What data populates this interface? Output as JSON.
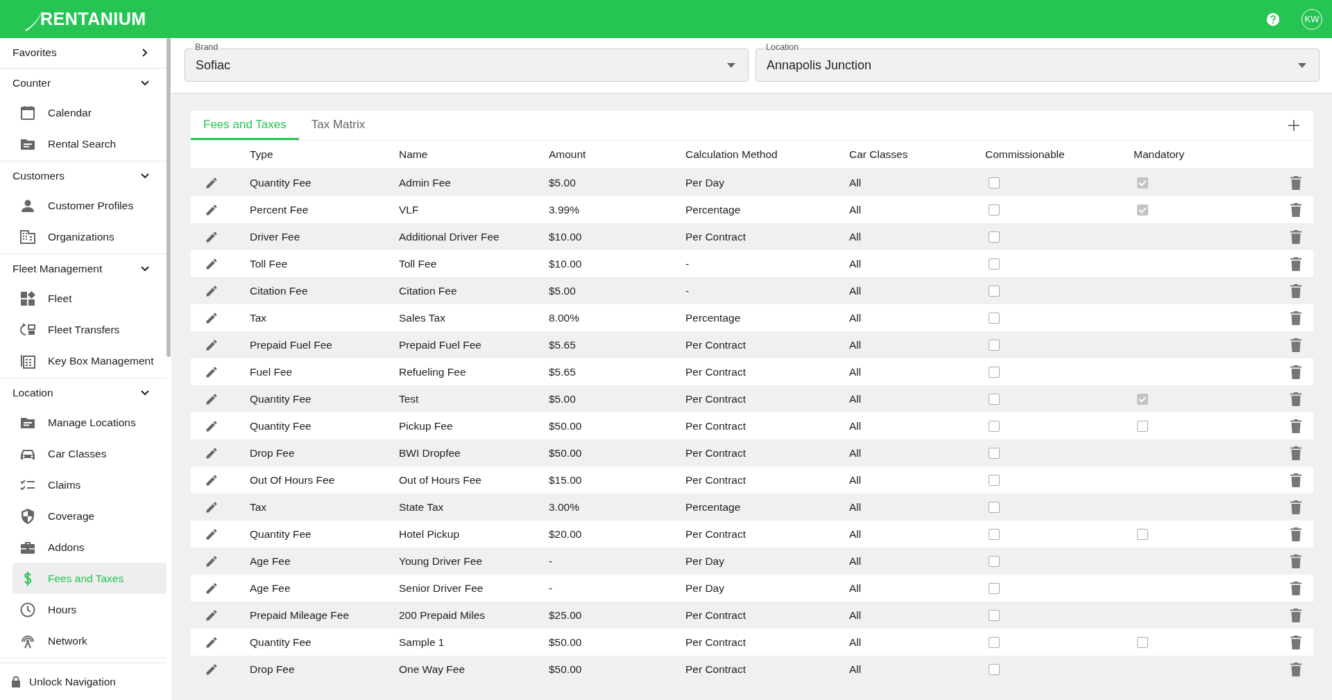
{
  "app": {
    "logo": "RENTANIUM",
    "avatar": "KW"
  },
  "sidebar": {
    "sections": [
      {
        "title": "Favorites",
        "expanded": false
      },
      {
        "title": "Counter",
        "expanded": true,
        "items": [
          {
            "label": "Calendar",
            "selected": false
          },
          {
            "label": "Rental Search",
            "selected": false
          }
        ]
      },
      {
        "title": "Customers",
        "expanded": true,
        "items": [
          {
            "label": "Customer Profiles",
            "selected": false
          },
          {
            "label": "Organizations",
            "selected": false
          }
        ]
      },
      {
        "title": "Fleet Management",
        "expanded": true,
        "items": [
          {
            "label": "Fleet",
            "selected": false
          },
          {
            "label": "Fleet Transfers",
            "selected": false
          },
          {
            "label": "Key Box Management",
            "selected": false
          }
        ]
      },
      {
        "title": "Location",
        "expanded": true,
        "items": [
          {
            "label": "Manage Locations",
            "selected": false
          },
          {
            "label": "Car Classes",
            "selected": false
          },
          {
            "label": "Claims",
            "selected": false
          },
          {
            "label": "Coverage",
            "selected": false
          },
          {
            "label": "Addons",
            "selected": false
          },
          {
            "label": "Fees and Taxes",
            "selected": true
          },
          {
            "label": "Hours",
            "selected": false
          },
          {
            "label": "Network",
            "selected": false
          }
        ]
      }
    ],
    "footer": "Unlock Navigation"
  },
  "filters": [
    {
      "label": "Brand",
      "value": "Sofiac"
    },
    {
      "label": "Location",
      "value": "Annapolis Junction"
    }
  ],
  "tabs": [
    {
      "label": "Fees and Taxes",
      "selected": true
    },
    {
      "label": "Tax Matrix",
      "selected": false
    }
  ],
  "table": {
    "columns": [
      "Type",
      "Name",
      "Amount",
      "Calculation Method",
      "Car Classes",
      "Commissionable",
      "Mandatory"
    ],
    "rows": [
      {
        "type": "Quantity Fee",
        "name": "Admin Fee",
        "amount": "$5.00",
        "method": "Per Day",
        "car_classes": "All",
        "commissionable": false,
        "mandatory": true
      },
      {
        "type": "Percent Fee",
        "name": "VLF",
        "amount": "3.99%",
        "method": "Percentage",
        "car_classes": "All",
        "commissionable": false,
        "mandatory": true
      },
      {
        "type": "Driver Fee",
        "name": "Additional Driver Fee",
        "amount": "$10.00",
        "method": "Per Contract",
        "car_classes": "All",
        "commissionable": false
      },
      {
        "type": "Toll Fee",
        "name": "Toll Fee",
        "amount": "$10.00",
        "method": "-",
        "car_classes": "All",
        "commissionable": false
      },
      {
        "type": "Citation Fee",
        "name": "Citation Fee",
        "amount": "$5.00",
        "method": "-",
        "car_classes": "All",
        "commissionable": false
      },
      {
        "type": "Tax",
        "name": "Sales Tax",
        "amount": "8.00%",
        "method": "Percentage",
        "car_classes": "All",
        "commissionable": false
      },
      {
        "type": "Prepaid Fuel Fee",
        "name": "Prepaid Fuel Fee",
        "amount": "$5.65",
        "method": "Per Contract",
        "car_classes": "All",
        "commissionable": false
      },
      {
        "type": "Fuel Fee",
        "name": "Refueling Fee",
        "amount": "$5.65",
        "method": "Per Contract",
        "car_classes": "All",
        "commissionable": false
      },
      {
        "type": "Quantity Fee",
        "name": "Test",
        "amount": "$5.00",
        "method": "Per Contract",
        "car_classes": "All",
        "commissionable": false,
        "mandatory": true
      },
      {
        "type": "Quantity Fee",
        "name": "Pickup Fee",
        "amount": "$50.00",
        "method": "Per Contract",
        "car_classes": "All",
        "commissionable": false,
        "mandatory": false
      },
      {
        "type": "Drop Fee",
        "name": "BWI Dropfee",
        "amount": "$50.00",
        "method": "Per Contract",
        "car_classes": "All",
        "commissionable": false
      },
      {
        "type": "Out Of Hours Fee",
        "name": "Out of Hours Fee",
        "amount": "$15.00",
        "method": "Per Contract",
        "car_classes": "All",
        "commissionable": false
      },
      {
        "type": "Tax",
        "name": "State Tax",
        "amount": "3.00%",
        "method": "Percentage",
        "car_classes": "All",
        "commissionable": false
      },
      {
        "type": "Quantity Fee",
        "name": "Hotel Pickup",
        "amount": "$20.00",
        "method": "Per Contract",
        "car_classes": "All",
        "commissionable": false,
        "mandatory": false
      },
      {
        "type": "Age Fee",
        "name": "Young Driver Fee",
        "amount": "-",
        "method": "Per Day",
        "car_classes": "All",
        "commissionable": false
      },
      {
        "type": "Age Fee",
        "name": "Senior Driver Fee",
        "amount": "-",
        "method": "Per Day",
        "car_classes": "All",
        "commissionable": false
      },
      {
        "type": "Prepaid Mileage Fee",
        "name": "200 Prepaid Miles",
        "amount": "$25.00",
        "method": "Per Contract",
        "car_classes": "All",
        "commissionable": false
      },
      {
        "type": "Quantity Fee",
        "name": "Sample 1",
        "amount": "$50.00",
        "method": "Per Contract",
        "car_classes": "All",
        "commissionable": false,
        "mandatory": false
      },
      {
        "type": "Drop Fee",
        "name": "One Way Fee",
        "amount": "$50.00",
        "method": "Per Contract",
        "car_classes": "All",
        "commissionable": false
      }
    ]
  }
}
